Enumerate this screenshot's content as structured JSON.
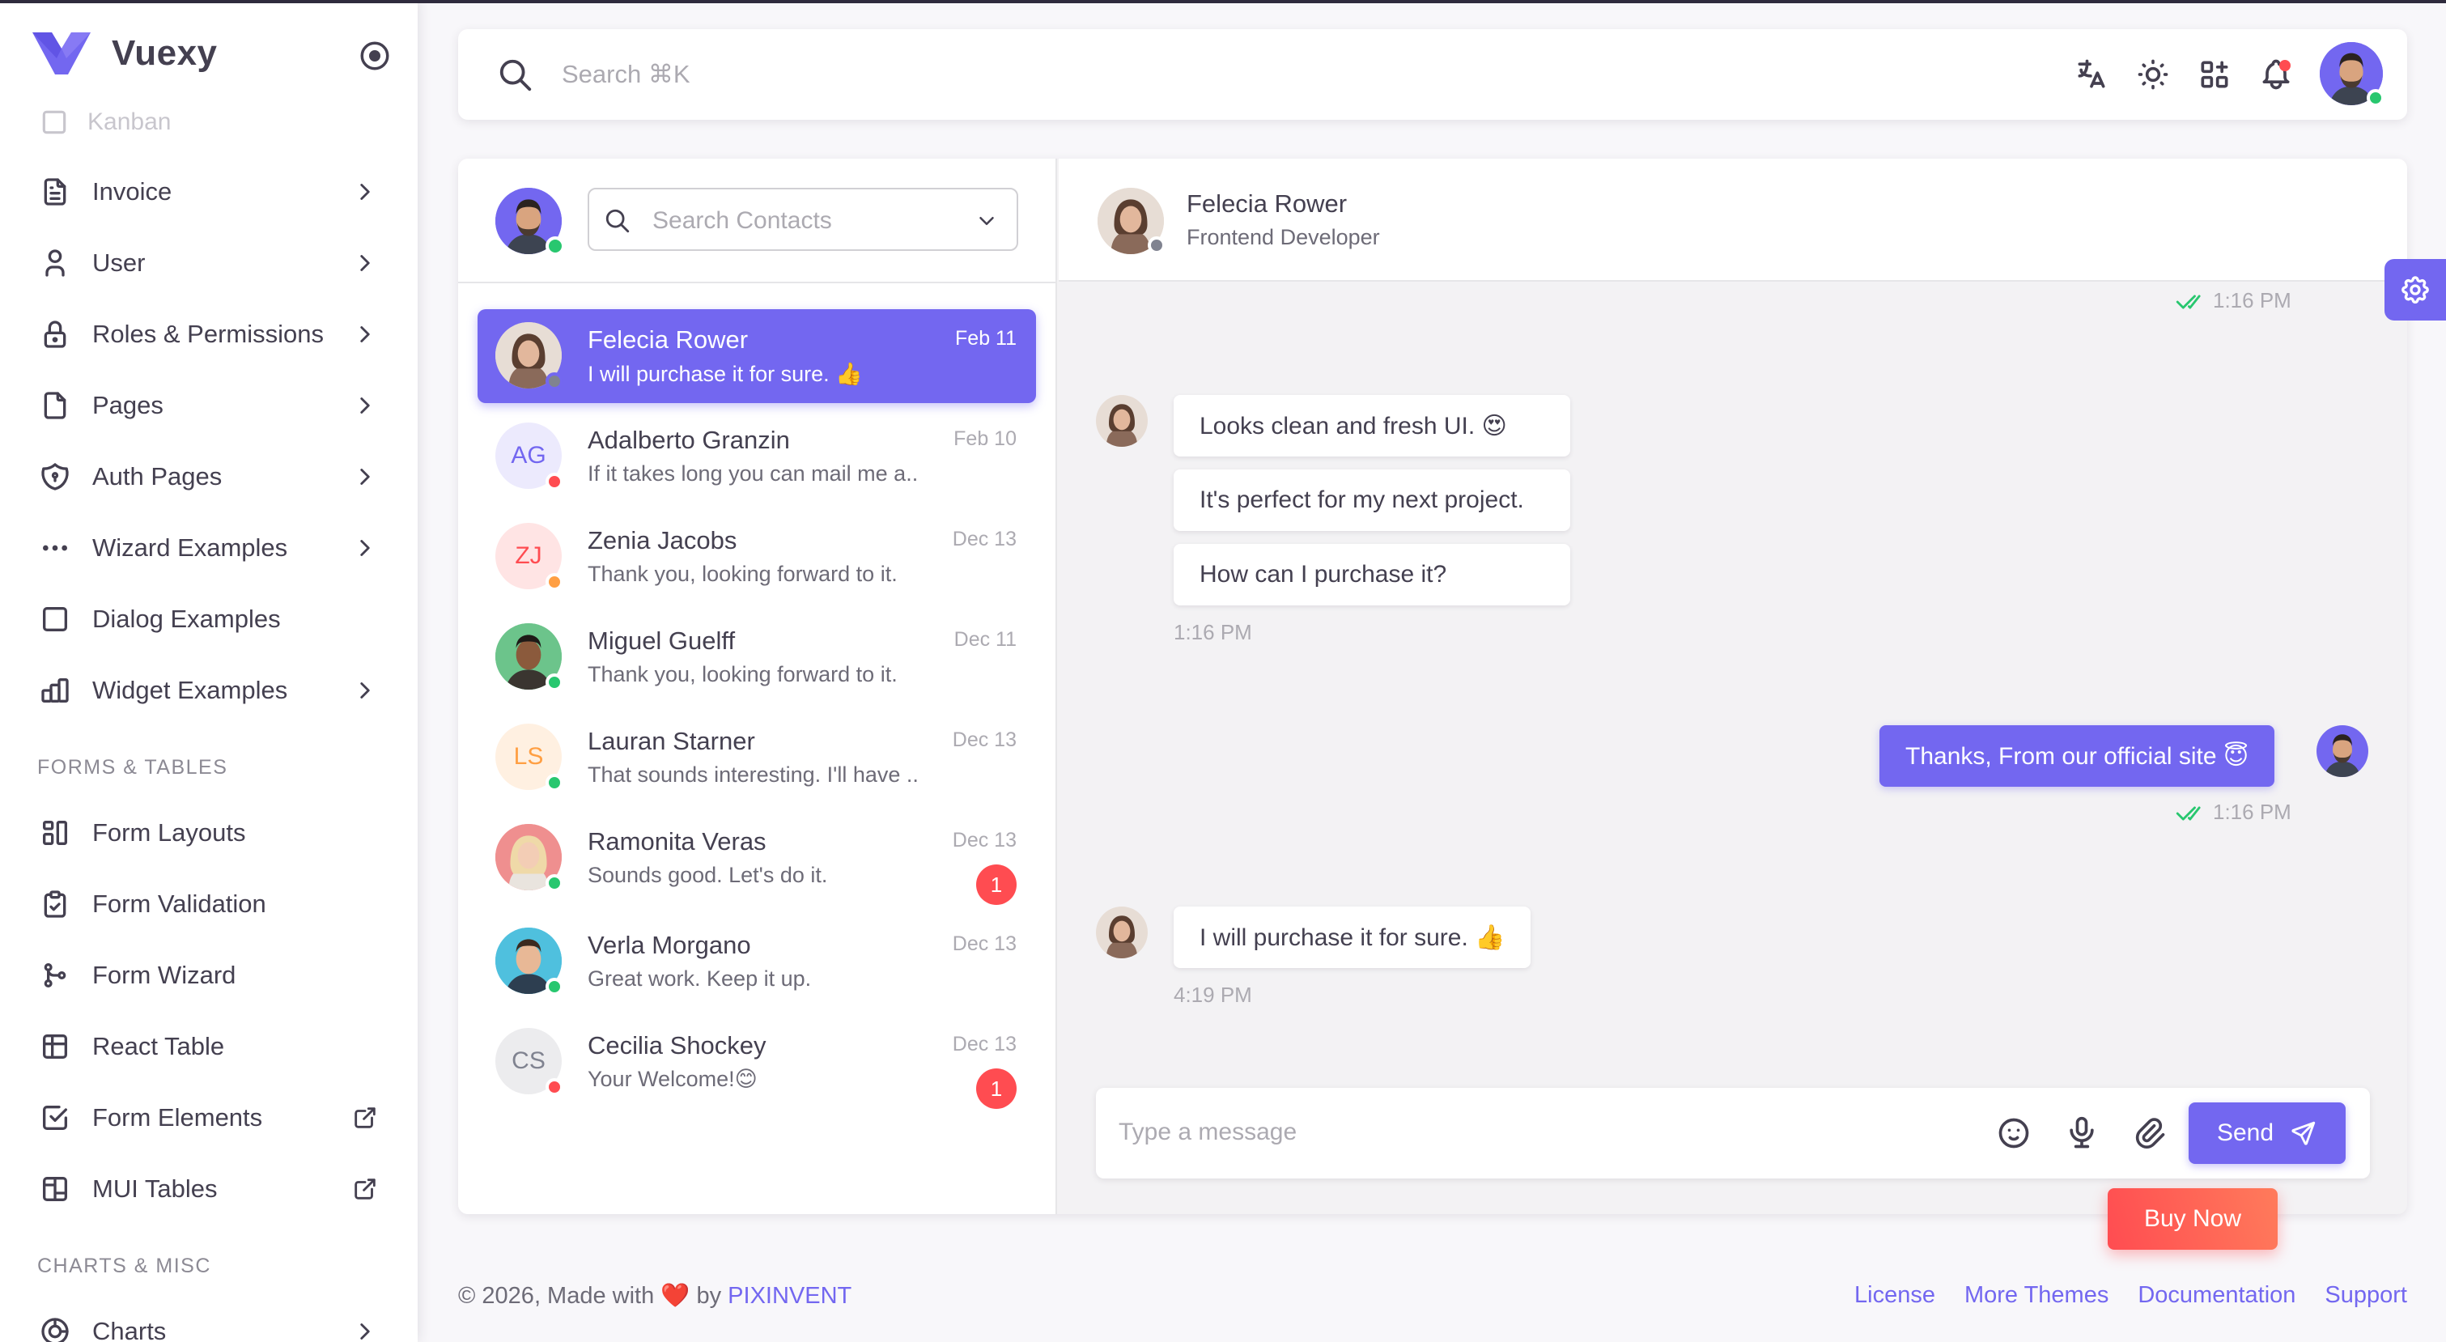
{
  "app": {
    "brand": "Vuexy",
    "primary_color": "#7367f0"
  },
  "sidebar": {
    "faded_item": "Kanban",
    "items": [
      {
        "label": "Invoice",
        "icon": "file-text-icon",
        "arrow": "chevron-right"
      },
      {
        "label": "User",
        "icon": "user-icon",
        "arrow": "chevron-right"
      },
      {
        "label": "Roles & Permissions",
        "icon": "lock-icon",
        "arrow": "chevron-right"
      },
      {
        "label": "Pages",
        "icon": "file-icon",
        "arrow": "chevron-right"
      },
      {
        "label": "Auth Pages",
        "icon": "shield-icon",
        "arrow": "chevron-right"
      },
      {
        "label": "Wizard Examples",
        "icon": "dots-icon",
        "arrow": "chevron-right"
      },
      {
        "label": "Dialog Examples",
        "icon": "square-icon",
        "arrow": ""
      },
      {
        "label": "Widget Examples",
        "icon": "chart-bar-icon",
        "arrow": "chevron-right"
      }
    ],
    "section_forms": "FORMS & TABLES",
    "forms_items": [
      {
        "label": "Form Layouts",
        "icon": "layout-icon",
        "arrow": ""
      },
      {
        "label": "Form Validation",
        "icon": "clipboard-check-icon",
        "arrow": ""
      },
      {
        "label": "Form Wizard",
        "icon": "git-merge-icon",
        "arrow": ""
      },
      {
        "label": "React Table",
        "icon": "table-icon",
        "arrow": ""
      },
      {
        "label": "Form Elements",
        "icon": "checkbox-icon",
        "arrow": "external-link"
      },
      {
        "label": "MUI Tables",
        "icon": "layout-board-icon",
        "arrow": "external-link"
      }
    ],
    "section_charts": "CHARTS & MISC",
    "charts_item": {
      "label": "Charts",
      "icon": "chart-donut-icon",
      "arrow": "chevron-right"
    }
  },
  "topbar": {
    "search_placeholder": "Search ⌘K",
    "icons": [
      "translate-icon",
      "sun-icon",
      "apps-icon",
      "bell-icon"
    ]
  },
  "contacts": {
    "search_placeholder": "Search Contacts",
    "list": [
      {
        "name": "Felecia Rower",
        "last_message": "I will purchase it for sure. 👍",
        "date": "Feb 11",
        "status": "offline",
        "active": true,
        "initials": "",
        "badge": ""
      },
      {
        "name": "Adalberto Granzin",
        "last_message": "If it takes long you can mail me a...",
        "date": "Feb 10",
        "status": "busy",
        "active": false,
        "initials": "AG",
        "badge": ""
      },
      {
        "name": "Zenia Jacobs",
        "last_message": "Thank you, looking forward to it.",
        "date": "Dec 13",
        "status": "away",
        "active": false,
        "initials": "ZJ",
        "badge": ""
      },
      {
        "name": "Miguel Guelff",
        "last_message": "Thank you, looking forward to it.",
        "date": "Dec 11",
        "status": "online",
        "active": false,
        "initials": "",
        "badge": ""
      },
      {
        "name": "Lauran Starner",
        "last_message": "That sounds interesting. I'll have ...",
        "date": "Dec 13",
        "status": "online",
        "active": false,
        "initials": "LS",
        "badge": ""
      },
      {
        "name": "Ramonita Veras",
        "last_message": "Sounds good. Let's do it.",
        "date": "Dec 13",
        "status": "online",
        "active": false,
        "initials": "",
        "badge": "1"
      },
      {
        "name": "Verla Morgano",
        "last_message": "Great work. Keep it up.",
        "date": "Dec 13",
        "status": "online",
        "active": false,
        "initials": "",
        "badge": ""
      },
      {
        "name": "Cecilia Shockey",
        "last_message": "Your Welcome!😊",
        "date": "Dec 13",
        "status": "busy",
        "active": false,
        "initials": "CS",
        "badge": "1"
      }
    ]
  },
  "chat": {
    "name": "Felecia Rower",
    "role": "Frontend Developer",
    "top_time": "1:16 PM",
    "received_group": [
      "Looks clean and fresh UI. 😍",
      "It's perfect for my next project.",
      "How can I purchase it?"
    ],
    "received_group_time": "1:16 PM",
    "sent_message": "Thanks, From our official site  😇",
    "sent_time": "1:16 PM",
    "last_received": "I will purchase it for sure. 👍",
    "last_received_time": "4:19 PM",
    "composer_placeholder": "Type a message",
    "send_label": "Send"
  },
  "buy_now": "Buy Now",
  "footer": {
    "prefix": "© 2026, Made with",
    "heart": "❤️",
    "by": "by",
    "brand": "PIXINVENT",
    "links": [
      "License",
      "More Themes",
      "Documentation",
      "Support"
    ]
  }
}
